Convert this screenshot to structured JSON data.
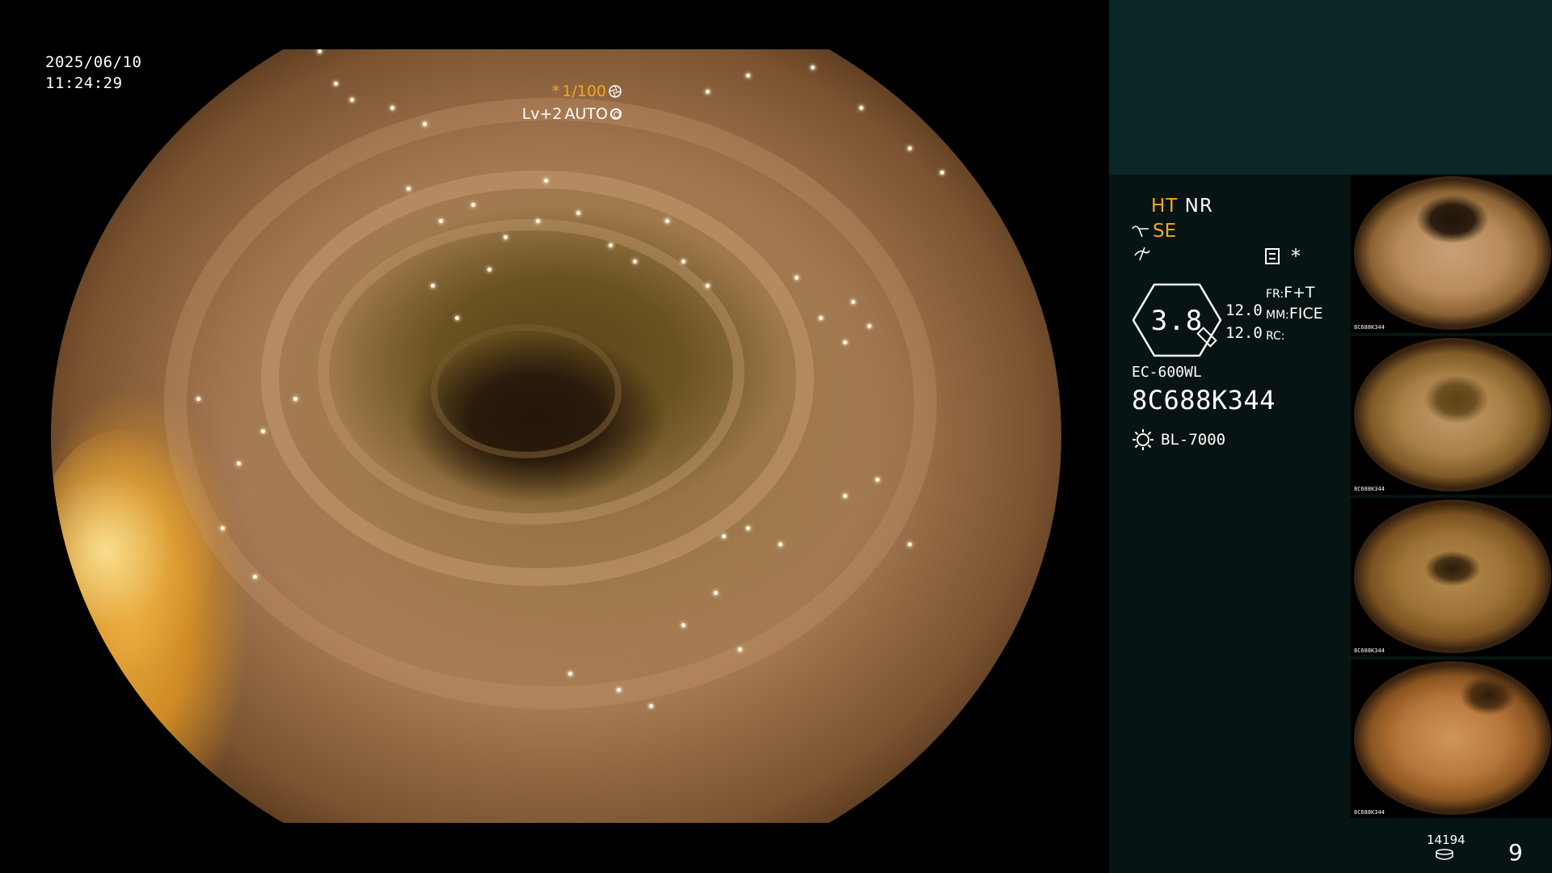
{
  "overlay": {
    "date": "2025/06/10",
    "time": "11:24:29",
    "shutter_prefix": "*",
    "shutter_value": "1/100",
    "level": "Lv+2",
    "mode": "AUTO"
  },
  "panel": {
    "ht": "HT",
    "nr": "NR",
    "se": "SE",
    "star": "*",
    "magnification": "3.8",
    "zoom_top": "12.0",
    "zoom_bottom": "12.0",
    "fr_label": "FR:",
    "fr_value": "F+T",
    "mm_label": "MM:",
    "mm_value": "FICE",
    "rc_label": "RC:",
    "scope_model": "EC-600WL",
    "scope_serial": "8C688K344",
    "light_source": "BL-7000",
    "image_count": "14194",
    "thumb_count": "9"
  },
  "thumbnails": [
    {
      "caption": "8C688K344"
    },
    {
      "caption": "8C688K344"
    },
    {
      "caption": "8C688K344"
    },
    {
      "caption": "8C688K344"
    }
  ],
  "colors": {
    "accent_orange": "#f2a71e",
    "panel_bg": "#061413",
    "panel_top_bg": "#0a2726"
  }
}
